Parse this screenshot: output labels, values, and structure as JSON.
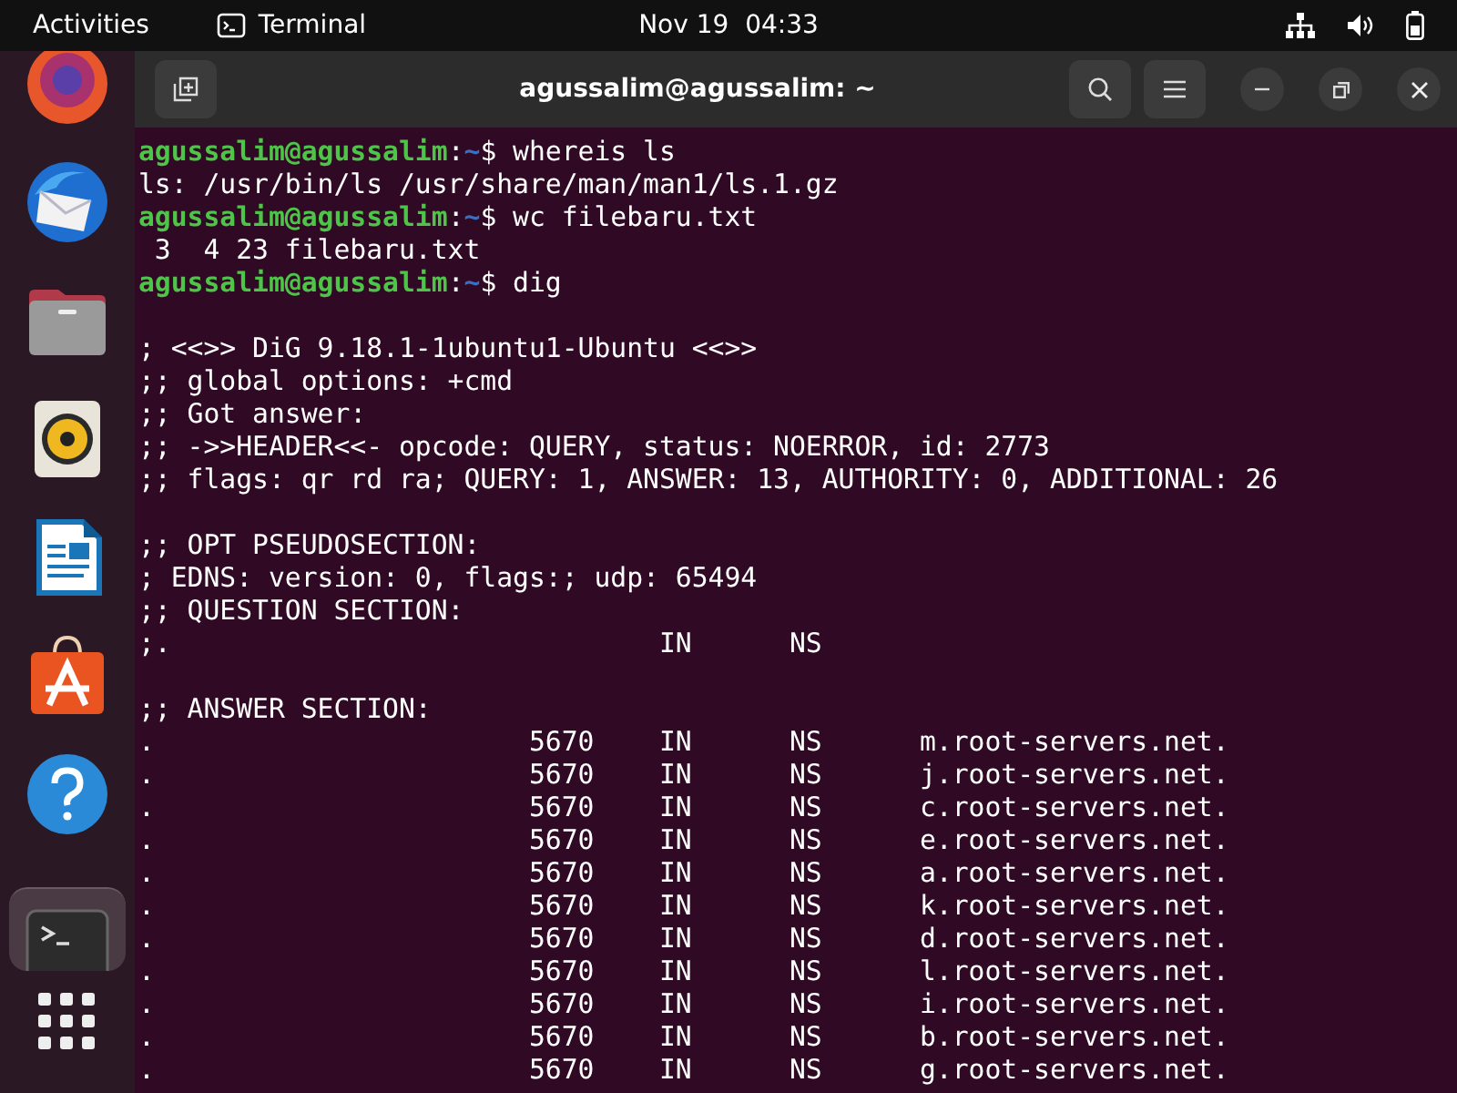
{
  "top_bar": {
    "activities": "Activities",
    "app_name": "Terminal",
    "clock": "Nov 19  04:33"
  },
  "dock": {
    "items": [
      {
        "kind": "firefox",
        "selected": false
      },
      {
        "kind": "thunderbird",
        "selected": false
      },
      {
        "kind": "files",
        "selected": false
      },
      {
        "kind": "rhythmbox",
        "selected": false
      },
      {
        "kind": "writer",
        "selected": false
      },
      {
        "kind": "software",
        "selected": false
      },
      {
        "kind": "help",
        "selected": false
      },
      {
        "kind": "terminal",
        "selected": true
      }
    ]
  },
  "window": {
    "title": "agussalim@agussalim: ~"
  },
  "terminal": {
    "lines": [
      {
        "kind": "prompt",
        "user": "agussalim@agussalim",
        "sep": ":",
        "path": "~",
        "command": "$ whereis ls"
      },
      {
        "kind": "output",
        "text": "ls: /usr/bin/ls /usr/share/man/man1/ls.1.gz"
      },
      {
        "kind": "prompt",
        "user": "agussalim@agussalim",
        "sep": ":",
        "path": "~",
        "command": "$ wc filebaru.txt"
      },
      {
        "kind": "output",
        "text": " 3  4 23 filebaru.txt"
      },
      {
        "kind": "prompt",
        "user": "agussalim@agussalim",
        "sep": ":",
        "path": "~",
        "command": "$ dig"
      },
      {
        "kind": "blank"
      },
      {
        "kind": "output",
        "text": "; <<>> DiG 9.18.1-1ubuntu1-Ubuntu <<>>"
      },
      {
        "kind": "output",
        "text": ";; global options: +cmd"
      },
      {
        "kind": "output",
        "text": ";; Got answer:"
      },
      {
        "kind": "output",
        "text": ";; ->>HEADER<<- opcode: QUERY, status: NOERROR, id: 2773"
      },
      {
        "kind": "output",
        "text": ";; flags: qr rd ra; QUERY: 1, ANSWER: 13, AUTHORITY: 0, ADDITIONAL: 26"
      },
      {
        "kind": "blank"
      },
      {
        "kind": "output",
        "text": ";; OPT PSEUDOSECTION:"
      },
      {
        "kind": "output",
        "text": "; EDNS: version: 0, flags:; udp: 65494"
      },
      {
        "kind": "output",
        "text": ";; QUESTION SECTION:"
      },
      {
        "kind": "output",
        "text": ";.                              IN      NS"
      },
      {
        "kind": "blank"
      },
      {
        "kind": "output",
        "text": ";; ANSWER SECTION:"
      },
      {
        "kind": "output",
        "text": ".                       5670    IN      NS      m.root-servers.net."
      },
      {
        "kind": "output",
        "text": ".                       5670    IN      NS      j.root-servers.net."
      },
      {
        "kind": "output",
        "text": ".                       5670    IN      NS      c.root-servers.net."
      },
      {
        "kind": "output",
        "text": ".                       5670    IN      NS      e.root-servers.net."
      },
      {
        "kind": "output",
        "text": ".                       5670    IN      NS      a.root-servers.net."
      },
      {
        "kind": "output",
        "text": ".                       5670    IN      NS      k.root-servers.net."
      },
      {
        "kind": "output",
        "text": ".                       5670    IN      NS      d.root-servers.net."
      },
      {
        "kind": "output",
        "text": ".                       5670    IN      NS      l.root-servers.net."
      },
      {
        "kind": "output",
        "text": ".                       5670    IN      NS      i.root-servers.net."
      },
      {
        "kind": "output",
        "text": ".                       5670    IN      NS      b.root-servers.net."
      },
      {
        "kind": "output",
        "text": ".                       5670    IN      NS      g.root-servers.net."
      }
    ]
  }
}
